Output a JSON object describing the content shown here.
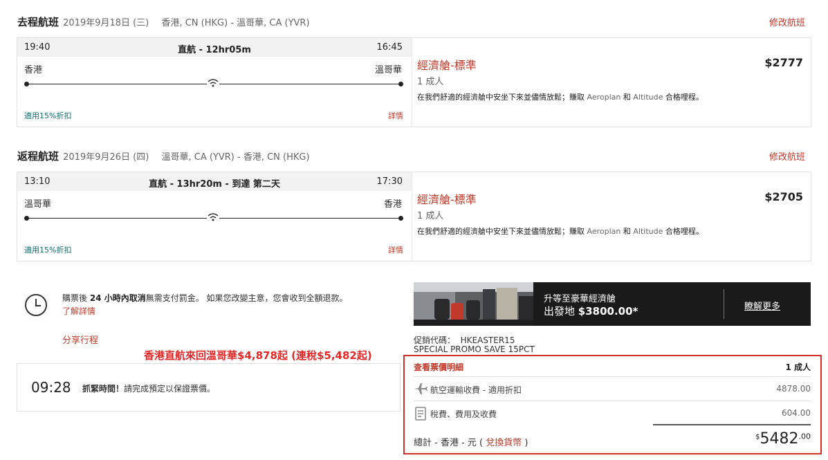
{
  "outbound": {
    "heading": "去程航班",
    "date": "2019年9月18日 (三)",
    "route": "香港, CN (HKG) - 溫哥華, CA (YVR)",
    "modify": "修改航班",
    "depart_time": "19:40",
    "duration": "直航 - 12hr05m",
    "arrive_time": "16:45",
    "origin": "香港",
    "destination": "溫哥華",
    "discount": "適用15%折扣",
    "details": "詳情",
    "cabin": "經濟艙-標準",
    "pax": "1 成人",
    "desc_a": "在我們舒適的經濟艙中安坐下來並儘情放鬆；賺取 ",
    "desc_b": "Aeroplan",
    "desc_c": " 和 ",
    "desc_d": "Altitude",
    "desc_e": " 合格哩程。",
    "price": "$2777"
  },
  "inbound": {
    "heading": "返程航班",
    "date": "2019年9月26日 (四)",
    "route": "溫哥華, CA (YVR) - 香港, CN (HKG)",
    "modify": "修改航班",
    "depart_time": "13:10",
    "duration": "直航 - 13hr20m - 到達 第二天",
    "arrive_time": "17:30",
    "origin": "溫哥華",
    "destination": "香港",
    "discount": "適用15%折扣",
    "details": "詳情",
    "cabin": "經濟艙-標準",
    "pax": "1 成人",
    "desc_a": "在我們舒適的經濟艙中安坐下來並儘情放鬆；賺取 ",
    "desc_b": "Aeroplan",
    "desc_c": " 和 ",
    "desc_d": "Altitude",
    "desc_e": " 合格哩程。",
    "price": "$2705"
  },
  "cancel": {
    "pre": "購票後 ",
    "bold": "24 小時內取消",
    "post": "無需支付罰金。 如果您改變主意，您會收到全額退款。",
    "learn_more": "了解詳情",
    "share": "分享行程"
  },
  "promo_headline": "香港直航來回溫哥華$4,878起 (連稅$5,482起)",
  "timer": {
    "time": "09:28",
    "bold": "抓緊時間！",
    "text": "請完成預定以保證票價。"
  },
  "upgrade": {
    "line1": "升等至豪華經濟艙",
    "line2_prefix": "出發地 ",
    "line2_price": "$3800.00*",
    "learn_more": "瞭解更多"
  },
  "promo_code": {
    "label": "促銷代碼：  HKEASTER15",
    "name": "SPECIAL PROMO SAVE 15PCT"
  },
  "breakdown": {
    "title": "查看票價明細",
    "pax": "1 成人",
    "air_label": "航空運輸收費 - 適用折扣",
    "air_value": "4878.00",
    "tax_label": "稅費、費用及收費",
    "tax_value": "604.00",
    "total_label": "總計 - 香港 - 元",
    "currency_open": " ( ",
    "currency_link": "兌換貨幣",
    "currency_close": " )",
    "total_symbol": "$",
    "total_main": "5482",
    "total_cents": ".00"
  },
  "colors": {
    "brand_red": "#c0392b",
    "highlight_border": "#d32f2f",
    "teal_link": "#0b6e6e"
  }
}
